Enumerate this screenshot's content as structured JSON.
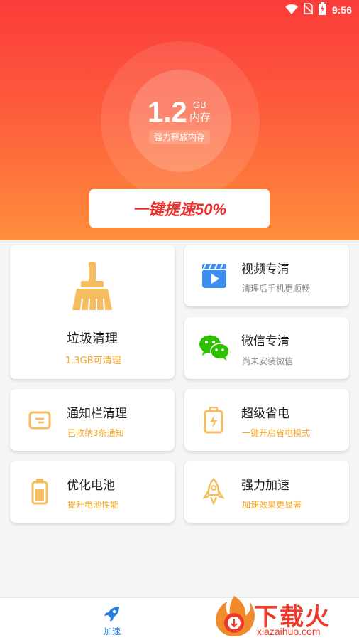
{
  "status_bar": {
    "time": "9:56",
    "icons": [
      "wifi-icon",
      "no-sim-icon",
      "battery-charging-icon"
    ]
  },
  "header": {
    "memory_value": "1.2",
    "memory_unit": "GB",
    "memory_label": "内存",
    "memory_sub": "强力释放内存",
    "boost_button_label": "一键提速50%",
    "colors": {
      "gradient_top": "#fc3b3a",
      "gradient_bottom": "#ff8e3c"
    }
  },
  "cards": {
    "junk": {
      "title": "垃圾清理",
      "subtitle": "1.3GB可清理",
      "icon": "broom-icon"
    },
    "video": {
      "title": "视频专清",
      "subtitle": "清理后手机更顺畅",
      "icon": "video-clapper-icon"
    },
    "wechat": {
      "title": "微信专清",
      "subtitle": "尚未安装微信",
      "icon": "wechat-icon"
    },
    "notification": {
      "title": "通知栏清理",
      "subtitle": "已收纳3条通知",
      "icon": "notification-icon"
    },
    "power_save": {
      "title": "超级省电",
      "subtitle": "一键开启省电模式",
      "icon": "power-save-icon"
    },
    "battery": {
      "title": "优化电池",
      "subtitle": "提升电池性能",
      "icon": "battery-icon"
    },
    "speed": {
      "title": "强力加速",
      "subtitle": "加速效果更显著",
      "icon": "rocket-icon"
    }
  },
  "accent_color": "#f5a623",
  "bottom_nav": {
    "items": [
      {
        "label": "加速",
        "icon": "rocket-icon",
        "active": true
      }
    ],
    "active_color": "#2a7de1"
  },
  "watermark": {
    "text": "下载火",
    "url": "xiazaihuo.com"
  }
}
